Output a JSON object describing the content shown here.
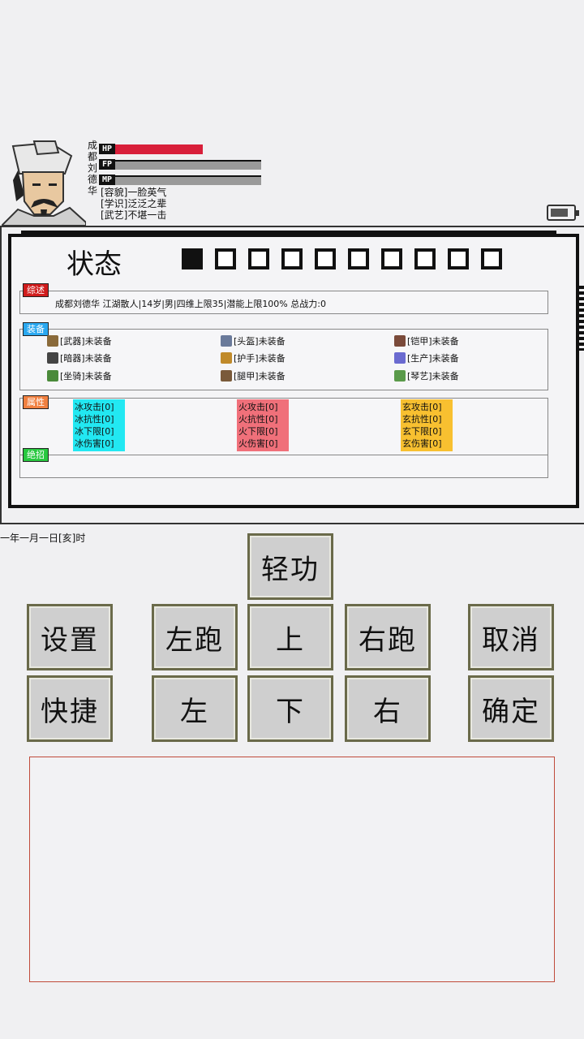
{
  "character": {
    "name_chars": [
      "成",
      "都",
      "刘",
      "德",
      "华"
    ],
    "bars": [
      {
        "label": "HP",
        "fill": 0.6,
        "color": "#d81f3a"
      },
      {
        "label": "FP",
        "fill": 1.0,
        "color": "#9a9a9a"
      },
      {
        "label": "MP",
        "fill": 1.0,
        "color": "#9a9a9a"
      }
    ],
    "traits": [
      "[容貌]一脸英气",
      "[学识]泛泛之辈",
      "[武艺]不堪一击"
    ]
  },
  "battery": {
    "level": 0.8
  },
  "status_panel": {
    "title": "状态",
    "page_count": 10,
    "active_page": 0,
    "summary": {
      "tag": "综述",
      "tag_color": "#d01c1c",
      "text": "成都刘德华  江湖散人|14岁|男|四维上限35|潜能上限100%  总战力:0"
    },
    "equipment": {
      "tag": "装备",
      "tag_color": "#2aa8f0",
      "items": [
        {
          "label": "[武器]未装备",
          "icon": "sword-icon",
          "color": "#8a6a3a"
        },
        {
          "label": "[头盔]未装备",
          "icon": "helmet-icon",
          "color": "#6a7a9a"
        },
        {
          "label": "[铠甲]未装备",
          "icon": "armor-icon",
          "color": "#7a4a3a"
        },
        {
          "label": "[暗器]未装备",
          "icon": "dart-icon",
          "color": "#444444"
        },
        {
          "label": "[护手]未装备",
          "icon": "glove-icon",
          "color": "#c08a2a"
        },
        {
          "label": "[生产]未装备",
          "icon": "tool-icon",
          "color": "#6a6ad0"
        },
        {
          "label": "[坐骑]未装备",
          "icon": "mount-icon",
          "color": "#4a8a3a"
        },
        {
          "label": "[腿甲]未装备",
          "icon": "boots-icon",
          "color": "#7a5a3a"
        },
        {
          "label": "[琴艺]未装备",
          "icon": "instrument-icon",
          "color": "#5a9a4a"
        }
      ]
    },
    "attributes": {
      "tag": "属性",
      "tag_color": "#f08040",
      "groups": [
        {
          "color": "#22e8f2",
          "lines": [
            "冰攻击[0]",
            "冰抗性[0]",
            "冰下限[0]",
            "冰伤害[0]"
          ]
        },
        {
          "color": "#f0707a",
          "lines": [
            "火攻击[0]",
            "火抗性[0]",
            "火下限[0]",
            "火伤害[0]"
          ]
        },
        {
          "color": "#f8c030",
          "lines": [
            "玄攻击[0]",
            "玄抗性[0]",
            "玄下限[0]",
            "玄伤害[0]"
          ]
        }
      ]
    },
    "skills": {
      "tag": "绝招",
      "tag_color": "#28c840"
    }
  },
  "date_text": "一年一月一日[亥]时",
  "controls": {
    "qinggong": "轻功",
    "settings": "设置",
    "left_run": "左跑",
    "up": "上",
    "right_run": "右跑",
    "cancel": "取消",
    "shortcut": "快捷",
    "left": "左",
    "down": "下",
    "right": "右",
    "confirm": "确定"
  }
}
